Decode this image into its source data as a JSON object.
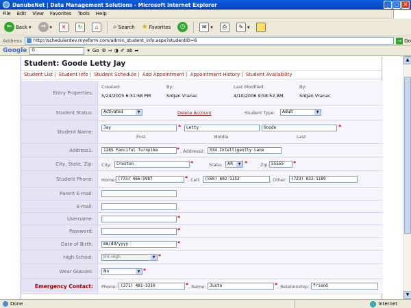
{
  "window": {
    "title": "DanubeNet | Data Management Solutions - Microsoft Internet Explorer"
  },
  "menu": [
    "File",
    "Edit",
    "View",
    "Favorites",
    "Tools",
    "Help"
  ],
  "toolbar": {
    "back": "Back",
    "search": "Search",
    "favorites": "Favorites"
  },
  "address": {
    "label": "Address",
    "url": "http://schedulerdev.myeform.com/admin_student_info.aspx?studentID=6",
    "go": "Go"
  },
  "google": {
    "logo": "Google",
    "search_placeholder": "G",
    "go": "Go"
  },
  "page": {
    "title": "Student: Goode Letty Jay",
    "nav": [
      "Student List",
      "Student Info",
      "Student Schedule",
      "Add Appointment",
      "Appointment History",
      "Student Availability"
    ],
    "entry": {
      "label": "Entry Properties:",
      "created_h": "Created:",
      "by_h": "By:",
      "modified_h": "Last Modified:",
      "by2_h": "By:",
      "created": "5/24/2005 6:31:58 PM",
      "by": "Srdjan Vranac",
      "modified": "4/10/2006 9:58:52 AM",
      "by2": "Srdjan Vranac"
    },
    "status": {
      "label": "Student Status:",
      "value": "Activated",
      "delete": "Delete Account",
      "type_label": "Student Type:",
      "type_value": "Adult"
    },
    "name": {
      "label": "Student Name:",
      "first": "Jay",
      "middle": "Letty",
      "last": "Goode",
      "first_l": "First",
      "middle_l": "Middle",
      "last_l": "Last"
    },
    "address": {
      "label": "Address1:",
      "addr1": "1285 Fanciful Turnpike",
      "addr2_label": ", Address2:",
      "addr2": "534 Intelligently Lane"
    },
    "csz": {
      "label": "City, State, Zip:",
      "city_l": "City:",
      "city": "Creston",
      "state_l": "State:",
      "state": "AR",
      "zip_l": "Zip:",
      "zip": "55555"
    },
    "phone": {
      "label": "Student Phone:",
      "home_l": "Home:",
      "home": "(773) 466-5987",
      "cell_l": ", Cell:",
      "cell": "(550) 602-1152",
      "other_l": ", Other:",
      "other": "(723) 832-1189"
    },
    "parent_email": {
      "label": "Parent E-mail:",
      "value": ""
    },
    "email": {
      "label": "E-mail:",
      "value": ""
    },
    "username": {
      "label": "Username:",
      "value": ""
    },
    "password": {
      "label": "Password:",
      "value": ""
    },
    "dob": {
      "label": "Date of Birth:",
      "value": "mm/dd/yyyy"
    },
    "school": {
      "label": "High School:",
      "value": "JFK High"
    },
    "glasses": {
      "label": "Wear Glasses:",
      "value": "No"
    },
    "emergency": {
      "label": "Emergency Contact:",
      "phone_l": "Phone:",
      "phone": "(371) 481-3310",
      "name_l": ", Name:",
      "name": "Justa",
      "rel_l": ", Relationship:",
      "rel": "friend"
    }
  },
  "status": {
    "text": "Done",
    "zone": "Internet"
  }
}
